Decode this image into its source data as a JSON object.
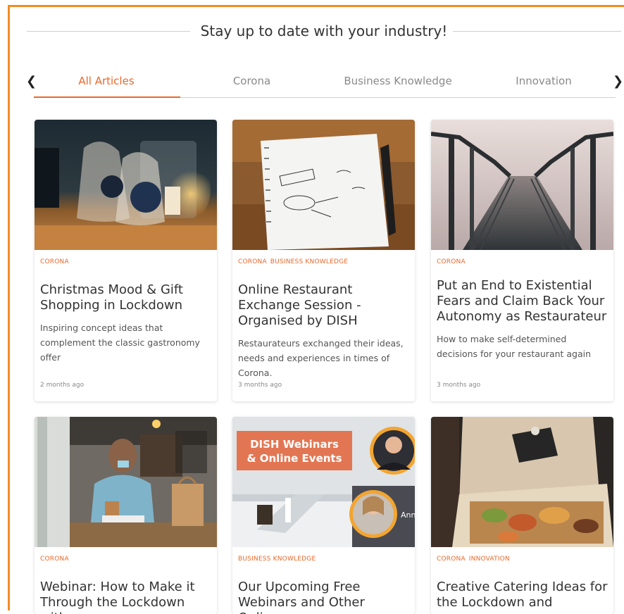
{
  "header": {
    "title": "Stay up to date with your industry!"
  },
  "tabs": {
    "prev_icon": "chevron-left-icon",
    "next_icon": "chevron-right-icon",
    "items": [
      {
        "label": "All Articles",
        "active": true
      },
      {
        "label": "Corona"
      },
      {
        "label": "Business Knowledge"
      },
      {
        "label": "Innovation"
      }
    ]
  },
  "colors": {
    "accent": "#e8682a",
    "frame": "#f28c22"
  },
  "cards": [
    {
      "tags": [
        "CORONA"
      ],
      "title": "Christmas Mood & Gift Shopping in Lockdown",
      "description": "Inspiring concept ideas that complement the classic gastronomy offer",
      "date": "2 months ago",
      "image": "gift-bags-photo"
    },
    {
      "tags": [
        "CORONA",
        "BUSINESS KNOWLEDGE"
      ],
      "title": "Online Restaurant Exchange Session - Organised by DISH",
      "description": "Restaurateurs exchanged their ideas, needs and experiences in times of Corona.",
      "date": "3 months ago",
      "image": "notebook-photo"
    },
    {
      "tags": [
        "CORONA"
      ],
      "title": "Put an End to Existential Fears and Claim Back Your Autonomy as Restaurateur",
      "description": "How to make self-determined decisions for your restaurant again",
      "date": "3 months ago",
      "image": "foggy-bridge-photo"
    },
    {
      "tags": [
        "CORONA"
      ],
      "title": "Webinar: How to Make it Through the Lockdown with",
      "image": "takeaway-counter-photo"
    },
    {
      "tags": [
        "BUSINESS KNOWLEDGE"
      ],
      "title": "Our Upcoming Free Webinars and Other Online",
      "image": "webinar-banner",
      "banner_text": [
        "DISH Webinars",
        "& Online Events"
      ],
      "banner_name": "Ann"
    },
    {
      "tags": [
        "CORONA",
        "INNOVATION"
      ],
      "title": "Creative Catering Ideas for the Lockdown and",
      "image": "catering-box-photo"
    }
  ]
}
